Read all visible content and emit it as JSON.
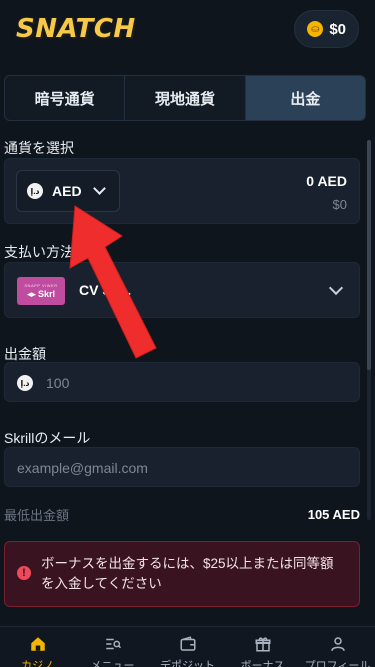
{
  "header": {
    "logo_text": "SNATCH",
    "balance": "$0"
  },
  "tabs": [
    {
      "label": "暗号通貨",
      "active": false
    },
    {
      "label": "現地通貨",
      "active": false
    },
    {
      "label": "出金",
      "active": true
    }
  ],
  "currency": {
    "label": "通貨を選択",
    "code": "AED",
    "amount": "0 AED",
    "usd_amount": "$0",
    "icon": "dirham-icon"
  },
  "payment": {
    "label": "支払い方法",
    "logo_small": "SNAPP VIWER",
    "logo_brand": "Skrl",
    "method_name": "CV Sk..."
  },
  "withdraw_amount": {
    "label": "出金額",
    "placeholder": "100"
  },
  "email": {
    "label": "Skrillのメール",
    "placeholder": "example@gmail.com"
  },
  "min_withdraw": {
    "label": "最低出金額",
    "value": "105 AED"
  },
  "alert": {
    "icon": "exclamation-icon",
    "text": "ボーナスを出金するには、$25以上または同等額を入金してください"
  },
  "bottom_nav": [
    {
      "label": "カジノ",
      "icon": "home-icon",
      "active": true
    },
    {
      "label": "メニュー",
      "icon": "menu-search-icon",
      "active": false
    },
    {
      "label": "デポジット",
      "icon": "wallet-icon",
      "active": false
    },
    {
      "label": "ボーナス",
      "icon": "gift-icon",
      "active": false
    },
    {
      "label": "プロフィール",
      "icon": "user-icon",
      "active": false
    }
  ],
  "colors": {
    "accent": "#f4b400",
    "active_tab": "#2b4158",
    "alert_bg": "#3a1320",
    "arrow": "#ef2d2d"
  }
}
